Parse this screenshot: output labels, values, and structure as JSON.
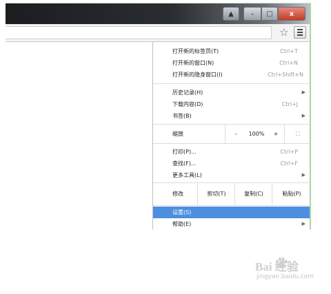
{
  "window": {
    "buttons": {
      "user": "▲",
      "minimize": "–",
      "maximize": "□",
      "close": "x"
    }
  },
  "toolbar": {
    "star_icon": "star-icon",
    "menu_icon": "hamburger-menu-icon"
  },
  "menu": {
    "group1": [
      {
        "label": "打开新的标签页(T)",
        "shortcut": "Ctrl+T"
      },
      {
        "label": "打开新的窗口(N)",
        "shortcut": "Ctrl+N"
      },
      {
        "label": "打开新的隐身窗口(I)",
        "shortcut": "Ctrl+Shift+N"
      }
    ],
    "group2": [
      {
        "label": "历史记录(H)",
        "arrow": "▶"
      },
      {
        "label": "下载内容(D)",
        "shortcut": "Ctrl+J"
      },
      {
        "label": "书签(B)",
        "arrow": "▶"
      }
    ],
    "zoom": {
      "label": "缩放",
      "minus": "-",
      "level": "100%",
      "plus": "+",
      "fullscreen": "⛶"
    },
    "group3": [
      {
        "label": "打印(P)...",
        "shortcut": "Ctrl+P"
      },
      {
        "label": "查找(F)...",
        "shortcut": "Ctrl+F"
      },
      {
        "label": "更多工具(L)",
        "arrow": "▶"
      }
    ],
    "edit": {
      "label": "修改",
      "cut": "剪切(T)",
      "copy": "复制(C)",
      "paste": "粘贴(P)"
    },
    "settings": {
      "label": "设置(S)"
    },
    "help": {
      "label": "帮助(E)",
      "arrow": "▶"
    }
  },
  "watermark": {
    "brand": "Bai  经验",
    "url": "jingyan.baidu.com"
  }
}
